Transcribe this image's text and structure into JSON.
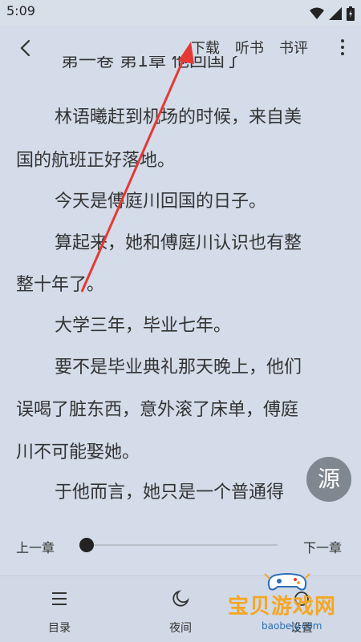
{
  "status": {
    "time": "5:09"
  },
  "topbar": {
    "download_label": "下载",
    "listen_label": "听书",
    "review_label": "书评"
  },
  "reading": {
    "chapter_title": "第一卷 第1章 他回国了",
    "lines": [
      "林语曦赶到机场的时候，来自美",
      "国的航班正好落地。",
      "今天是傅庭川回国的日子。",
      "算起来，她和傅庭川认识也有整",
      "整十年了。",
      "大学三年，毕业七年。",
      "要不是毕业典礼那天晚上，他们",
      "误喝了脏东西，意外滚了床单，傅庭",
      "川不可能娶她。",
      "于他而言，她只是一个普通得"
    ]
  },
  "source_button": {
    "label": "源"
  },
  "progress": {
    "prev_label": "上一章",
    "next_label": "下一章",
    "value": 0.0
  },
  "bottom_nav": {
    "catalog_label": "目录",
    "night_label": "夜间",
    "settings_label": "设置"
  },
  "watermark": {
    "text": "宝贝游戏网",
    "url": "baobeiy.com"
  },
  "colors": {
    "background": "#d3dce8",
    "annotation_arrow": "#e53935",
    "watermark_orange": "#f5a623"
  }
}
